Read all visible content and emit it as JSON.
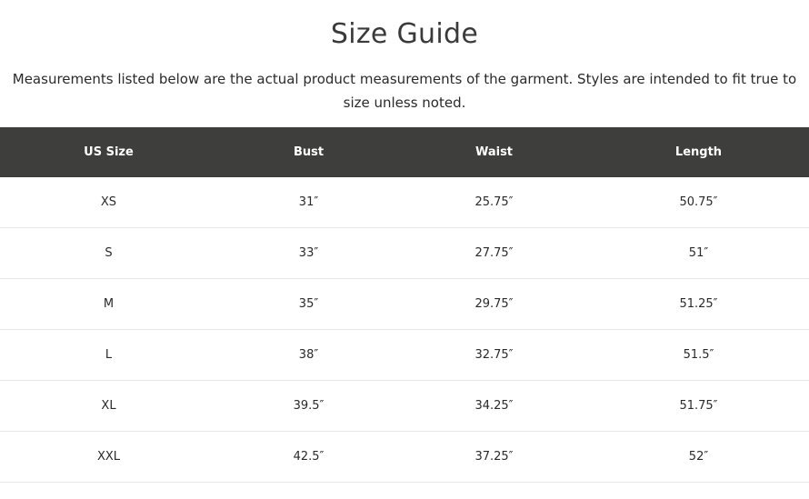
{
  "page": {
    "title": "Size Guide",
    "intro": "Measurements listed below are the actual product measurements of the garment. Styles are intended to fit true to size unless noted."
  },
  "colors": {
    "header_bg": "#3e3e3d",
    "header_text": "#ffffff",
    "row_border": "#e4e4e4",
    "title_text": "#3a3a3a"
  },
  "table": {
    "headers": [
      "US Size",
      "Bust",
      "Waist",
      "Length"
    ],
    "rows": [
      [
        "XS",
        "31″",
        "25.75″",
        "50.75″"
      ],
      [
        "S",
        "33″",
        "27.75″",
        "51″"
      ],
      [
        "M",
        "35″",
        "29.75″",
        "51.25″"
      ],
      [
        "L",
        "38″",
        "32.75″",
        "51.5″"
      ],
      [
        "XL",
        "39.5″",
        "34.25″",
        "51.75″"
      ],
      [
        "XXL",
        "42.5″",
        "37.25″",
        "52″"
      ]
    ]
  }
}
